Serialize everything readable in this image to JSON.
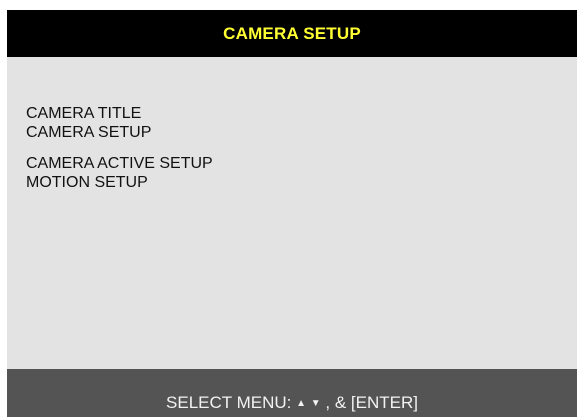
{
  "header": {
    "title": "CAMERA SETUP"
  },
  "menu": {
    "items": [
      {
        "label": "CAMERA TITLE"
      },
      {
        "label": "CAMERA SETUP"
      },
      {
        "label": "CAMERA ACTIVE SETUP"
      },
      {
        "label": "MOTION SETUP"
      }
    ]
  },
  "footer": {
    "prefix": "SELECT MENU:",
    "up_arrow": "▲",
    "down_arrow": "▼",
    "suffix": ", & [ENTER]"
  },
  "colors": {
    "title_bar_bg": "#000000",
    "title_text": "#ffff33",
    "panel_bg": "#e3e3e3",
    "footer_bg": "#545454",
    "footer_text": "#f2f2f2"
  }
}
